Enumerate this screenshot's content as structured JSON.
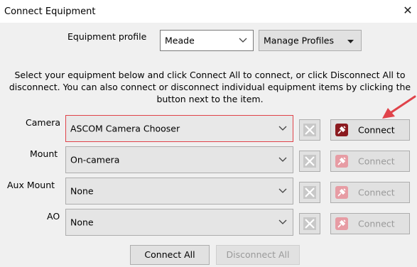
{
  "window": {
    "title": "Connect Equipment",
    "close_glyph": "✕"
  },
  "profile": {
    "label": "Equipment profile",
    "value": "Meade",
    "manage_label": "Manage Profiles"
  },
  "info_text": "Select your equipment below and click Connect All to connect, or click Disconnect All to disconnect. You can also connect or disconnect individual equipment items by clicking the button next to the item.",
  "rows": [
    {
      "label": "Camera",
      "value": "ASCOM Camera Chooser",
      "connect_label": "Connect",
      "enabled": true
    },
    {
      "label": "Mount",
      "value": "On-camera",
      "connect_label": "Connect",
      "enabled": false
    },
    {
      "label": "Aux Mount",
      "value": "None",
      "connect_label": "Connect",
      "enabled": false
    },
    {
      "label": "AO",
      "value": "None",
      "connect_label": "Connect",
      "enabled": false
    }
  ],
  "buttons": {
    "connect_all": "Connect All",
    "disconnect_all": "Disconnect All"
  },
  "icons": {
    "dropdown": "chevron-down-icon",
    "setup": "wrench-screwdriver-icon",
    "connect": "plug-icon",
    "annotation": "red-arrow-annotation"
  },
  "colors": {
    "accent_red": "#e0434a",
    "connect_icon": "#8b1a1f",
    "connect_icon_disabled": "#e79ca4"
  }
}
